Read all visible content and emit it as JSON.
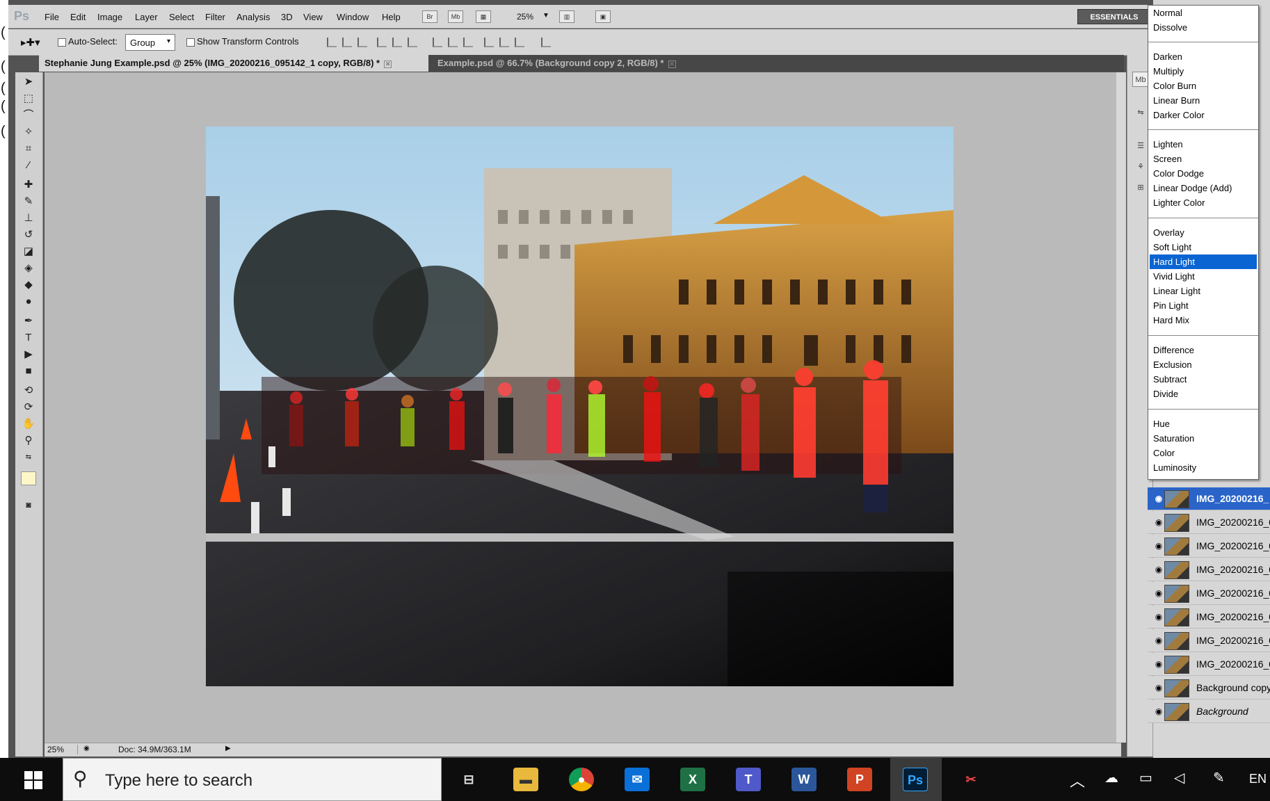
{
  "menubar": {
    "items": [
      "File",
      "Edit",
      "Image",
      "Layer",
      "Select",
      "Filter",
      "Analysis",
      "3D",
      "View",
      "Window",
      "Help"
    ],
    "zoom": "25%",
    "workspace": "ESSENTIALS",
    "bridge": "Br",
    "minibridge": "Mb"
  },
  "options": {
    "auto_select_label": "Auto-Select:",
    "auto_select_value": "Group",
    "show_transform": "Show Transform Controls"
  },
  "tabs": [
    {
      "title": "Stephanie Jung Example.psd @ 25% (IMG_20200216_095142_1 copy, RGB/8) *",
      "active": true
    },
    {
      "title": "Example.psd @ 66.7% (Background copy 2, RGB/8) *",
      "active": false
    }
  ],
  "status": {
    "zoom": "25%",
    "doc": "Doc: 34.9M/363.1M"
  },
  "blend_modes": {
    "groups": [
      [
        "Normal",
        "Dissolve"
      ],
      [
        "Darken",
        "Multiply",
        "Color Burn",
        "Linear Burn",
        "Darker Color"
      ],
      [
        "Lighten",
        "Screen",
        "Color Dodge",
        "Linear Dodge (Add)",
        "Lighter Color"
      ],
      [
        "Overlay",
        "Soft Light",
        "Hard Light",
        "Vivid Light",
        "Linear Light",
        "Pin Light",
        "Hard Mix"
      ],
      [
        "Difference",
        "Exclusion",
        "Subtract",
        "Divide"
      ],
      [
        "Hue",
        "Saturation",
        "Color",
        "Luminosity"
      ]
    ],
    "selected": "Hard Light"
  },
  "layers": [
    {
      "name": "IMG_20200216_",
      "selected": true
    },
    {
      "name": "IMG_20200216_0"
    },
    {
      "name": "IMG_20200216_0"
    },
    {
      "name": "IMG_20200216_0"
    },
    {
      "name": "IMG_20200216_0"
    },
    {
      "name": "IMG_20200216_0"
    },
    {
      "name": "IMG_20200216_0"
    },
    {
      "name": "IMG_20200216_0"
    },
    {
      "name": "Background copy"
    },
    {
      "name": "Background",
      "italic": true
    }
  ],
  "taskbar": {
    "search_placeholder": "Type here to search",
    "lang": "EN",
    "apps": [
      "task-view",
      "file-explorer",
      "chrome",
      "mail",
      "excel",
      "teams",
      "word",
      "powerpoint",
      "photoshop",
      "snip"
    ]
  },
  "colors": {
    "selection": "#0a64d1",
    "layer_selected": "#2a64c8",
    "ps_dark": "#535353",
    "canvas_bg": "#bababa"
  }
}
